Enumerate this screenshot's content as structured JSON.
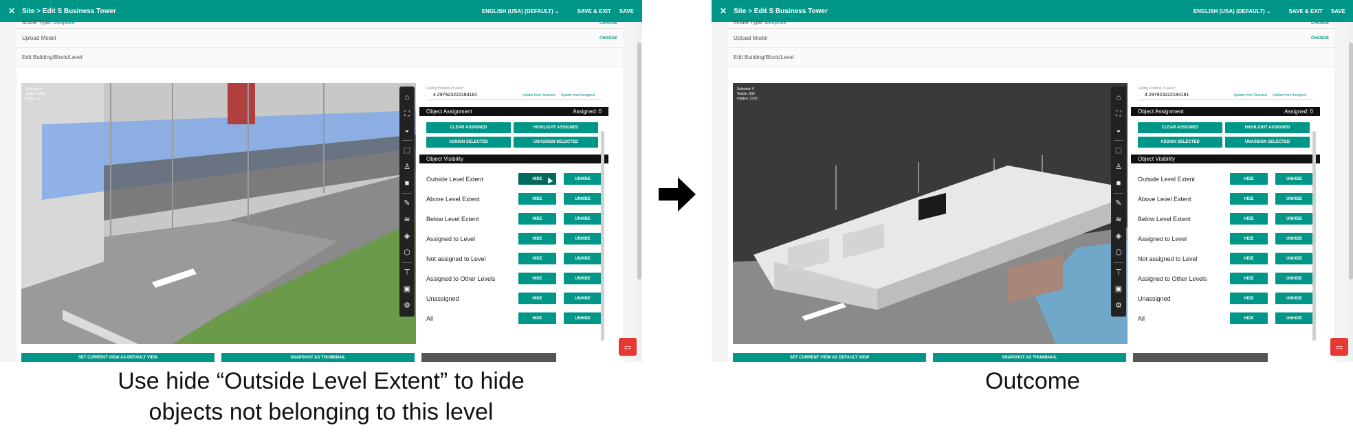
{
  "app": {
    "breadcrumb": "Site > Edit S Business Tower",
    "language": "ENGLISH (USA) (DEFAULT)",
    "save_exit": "SAVE & EXIT",
    "save": "SAVE"
  },
  "rows": {
    "model_type_label": "Model Type:",
    "model_type_value": "Bespoke",
    "change": "CHANGE",
    "upload_model": "Upload Model",
    "edit_building": "Edit Building/Block/Level"
  },
  "ceiling": {
    "label": "Ceiling Position (Y-axis)*",
    "value": "4.297923222184181",
    "update_selected": "Update from Selected",
    "update_assigned": "Update from Assigned"
  },
  "assignment": {
    "title": "Object Assignment",
    "assigned": "Assigned: 0",
    "buttons": [
      "CLEAR ASSIGNED",
      "HIGHLIGHT ASSIGNED",
      "ASSIGN SELECTED",
      "UNASSIGN SELECTED"
    ]
  },
  "visibility": {
    "title": "Object Visibility",
    "hide": "HIDE",
    "unhide": "UNHIDE",
    "rows": [
      "Outside Level Extent",
      "Above Level Extent",
      "Below Level Extent",
      "Assigned to Level",
      "Not assigned to Level",
      "Assigned to Other Levels",
      "Unassigned",
      "All"
    ]
  },
  "bottom": {
    "default_view": "SET CURRENT VIEW AS DEFAULT VIEW",
    "snapshot": "SNAPSHOT AS THUMBNAIL"
  },
  "left_stats": {
    "selected": "Selected: 1",
    "visible": "Visible: 3843",
    "hidden": "Hidden: 0"
  },
  "right_stats": {
    "selected": "Selected: 0",
    "visible": "Visible: 933",
    "hidden": "Hidden: 2730"
  },
  "captions": {
    "left_line1": "Use hide “Outside Level Extent” to hide",
    "left_line2": "objects not belonging to this level",
    "right": "Outcome"
  },
  "icons": [
    "home-icon",
    "fit-icon",
    "ceiling-icon",
    "select-box-icon",
    "walk-icon",
    "camera-icon",
    "pencil-icon",
    "layers-add-icon",
    "layers-icon",
    "cube-icon",
    "tree-icon",
    "save-icon",
    "settings-icon"
  ],
  "colors": {
    "accent": "#009688",
    "accent_dark": "#00695c",
    "chat": "#e53935"
  }
}
